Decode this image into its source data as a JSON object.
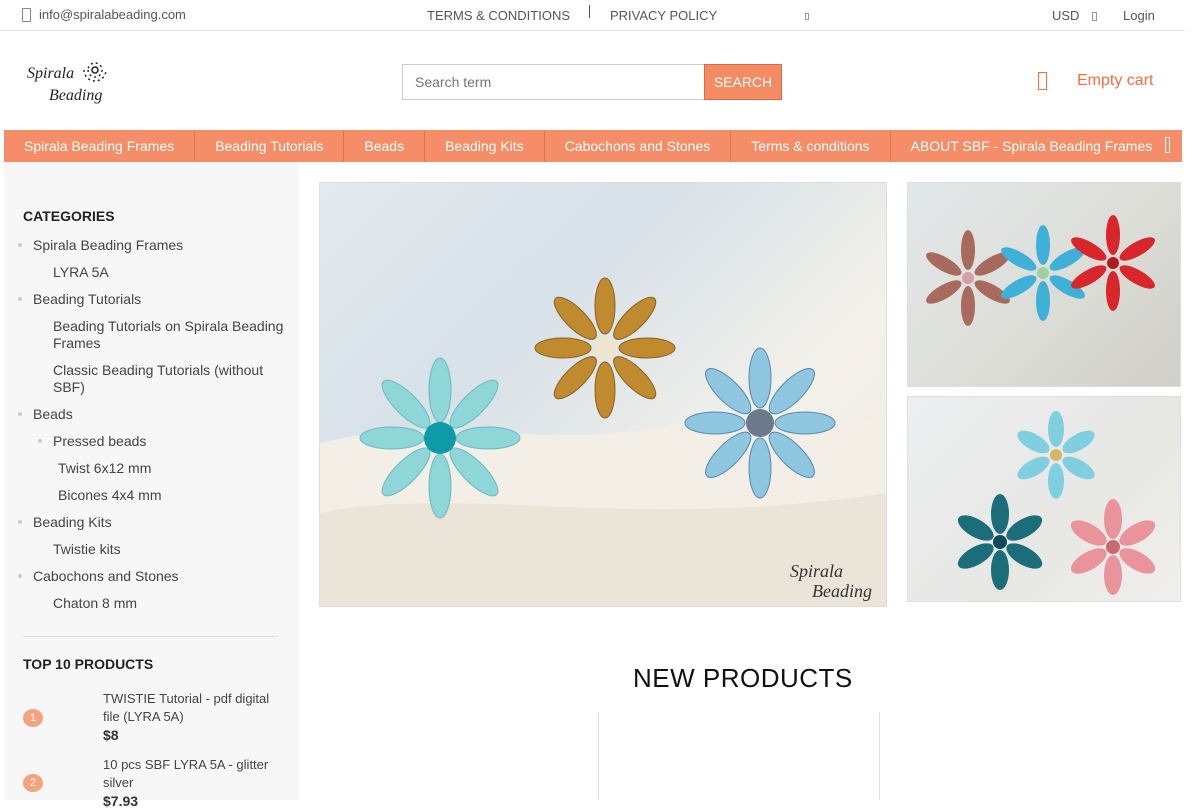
{
  "topbar": {
    "email": "info@spiralabeading.com",
    "terms": "TERMS & CONDITIONS",
    "privacy": "PRIVACY POLICY",
    "currency": "USD",
    "login": "Login"
  },
  "logo": {
    "line1": "Spirala",
    "line2": "Beading"
  },
  "search": {
    "placeholder": "Search term",
    "button": "SEARCH"
  },
  "cart": {
    "label": "Empty cart"
  },
  "nav": [
    "Spirala Beading Frames",
    "Beading Tutorials",
    "Beads",
    "Beading Kits",
    "Cabochons and Stones",
    "Terms & conditions",
    "ABOUT SBF - Spirala Beading Frames"
  ],
  "sidebar": {
    "categories_title": "CATEGORIES",
    "categories": [
      {
        "label": "Spirala Beading Frames",
        "level": 0
      },
      {
        "label": "LYRA 5A",
        "level": 1
      },
      {
        "label": "Beading Tutorials",
        "level": 0
      },
      {
        "label": "Beading Tutorials on Spirala Beading Frames",
        "level": 1
      },
      {
        "label": "Classic Beading Tutorials (without SBF)",
        "level": 1
      },
      {
        "label": "Beads",
        "level": 0
      },
      {
        "label": "Pressed beads",
        "level": 1
      },
      {
        "label": "Twist 6x12 mm",
        "level": 2
      },
      {
        "label": "Bicones 4x4 mm",
        "level": 2
      },
      {
        "label": "Beading Kits",
        "level": 0
      },
      {
        "label": "Twistie kits",
        "level": 1
      },
      {
        "label": "Cabochons and Stones",
        "level": 0
      },
      {
        "label": "Chaton 8 mm",
        "level": 1
      }
    ],
    "top10_title": "TOP 10 PRODUCTS",
    "top_products": [
      {
        "rank": "1",
        "name": "TWISTIE Tutorial - pdf digital file (LYRA 5A)",
        "price": "$8"
      },
      {
        "rank": "2",
        "name": "10 pcs SBF LYRA 5A - glitter silver",
        "price": "$7.93"
      }
    ]
  },
  "banner_watermark": {
    "line1": "Spirala",
    "line2": "Beading"
  },
  "new_products_heading": "NEW PRODUCTS"
}
